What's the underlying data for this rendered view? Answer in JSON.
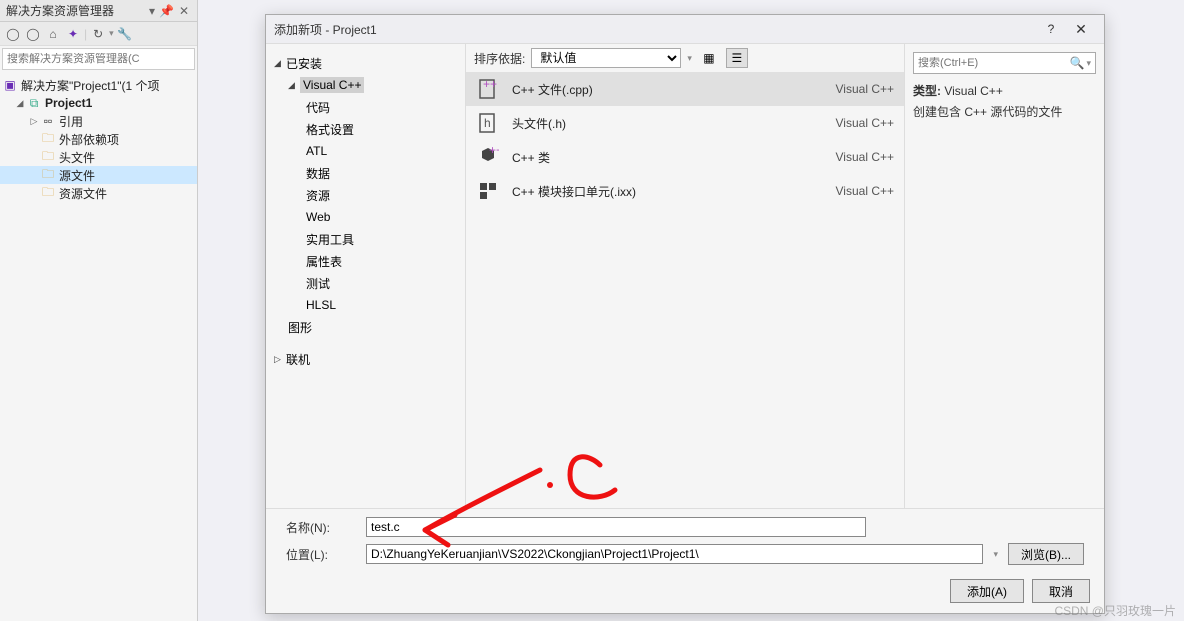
{
  "solution_panel": {
    "title": "解决方案资源管理器",
    "search_placeholder": "搜索解决方案资源管理器(C",
    "root": "解决方案\"Project1\"(1 个项",
    "project": "Project1",
    "items": {
      "references": "引用",
      "external": "外部依赖项",
      "headers": "头文件",
      "sources": "源文件",
      "resources": "资源文件"
    }
  },
  "dialog": {
    "title": "添加新项 - Project1",
    "help": "?",
    "left_tree": {
      "installed": "已安装",
      "visual_cpp": "Visual C++",
      "items": [
        "代码",
        "格式设置",
        "ATL",
        "数据",
        "资源",
        "Web",
        "实用工具",
        "属性表",
        "测试",
        "HLSL"
      ],
      "graphics": "图形",
      "online": "联机"
    },
    "sort_label": "排序依据:",
    "sort_value": "默认值",
    "templates": [
      {
        "name": "C++ 文件(.cpp)",
        "lang": "Visual C++",
        "icon": "cpp"
      },
      {
        "name": "头文件(.h)",
        "lang": "Visual C++",
        "icon": "h"
      },
      {
        "name": "C++ 类",
        "lang": "Visual C++",
        "icon": "class"
      },
      {
        "name": "C++ 模块接口单元(.ixx)",
        "lang": "Visual C++",
        "icon": "module"
      }
    ],
    "right": {
      "search_placeholder": "搜索(Ctrl+E)",
      "type_label": "类型:",
      "type_value": "Visual C++",
      "description": "创建包含 C++ 源代码的文件"
    },
    "name_label": "名称(N):",
    "name_value": "test.c",
    "location_label": "位置(L):",
    "location_value": "D:\\ZhuangYeKeruanjian\\VS2022\\Ckongjian\\Project1\\Project1\\",
    "browse": "浏览(B)...",
    "add": "添加(A)",
    "cancel": "取消"
  },
  "annotation_text": ".C",
  "watermark": "CSDN @只羽玫瑰一片"
}
